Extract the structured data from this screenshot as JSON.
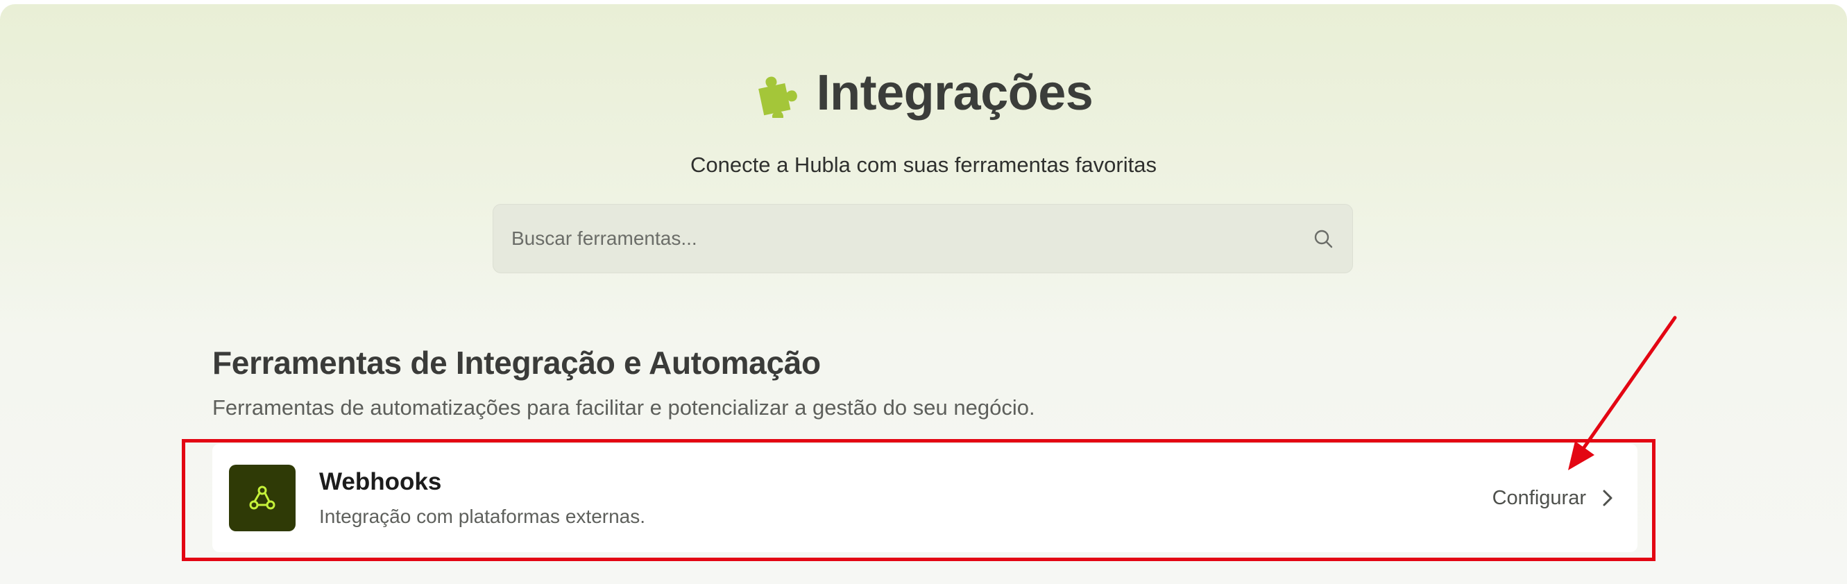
{
  "header": {
    "title": "Integrações",
    "subtitle": "Conecte a Hubla com suas ferramentas favoritas",
    "title_icon": "puzzle-piece-icon"
  },
  "search": {
    "placeholder": "Buscar ferramentas...",
    "value": "",
    "icon": "search-icon"
  },
  "section": {
    "title": "Ferramentas de Integração e Automação",
    "description": "Ferramentas de automatizações para facilitar e potencializar a gestão do seu negócio."
  },
  "integrations": [
    {
      "name": "Webhooks",
      "description": "Integração com plataformas externas.",
      "icon": "webhook-icon",
      "action_label": "Configurar",
      "action_icon": "chevron-right-icon"
    }
  ],
  "annotation": {
    "highlight_color": "#e30613"
  },
  "colors": {
    "accent_green": "#a4c639",
    "icon_bg": "#2f3a06",
    "icon_stroke": "#c5f23a"
  }
}
